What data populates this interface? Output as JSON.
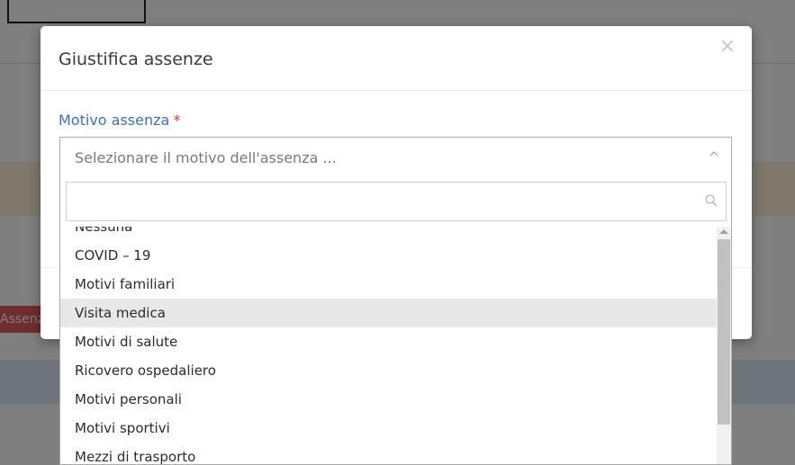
{
  "background": {
    "badge_text": "Assenza",
    "colors": {
      "backdrop": "#808080",
      "badge": "#e05a5a"
    }
  },
  "modal": {
    "title": "Giustifica assenze",
    "close_label": "×",
    "field": {
      "label": "Motivo assenza",
      "required_mark": "*"
    },
    "select": {
      "placeholder": "Selezionare il motivo dell'assenza ...",
      "arrow_icon": "chevron-up-icon",
      "search": {
        "value": "",
        "placeholder": "",
        "icon": "search-icon"
      },
      "options": [
        "Nessuna",
        "COVID – 19",
        "Motivi familiari",
        "Visita medica",
        "Motivi di salute",
        "Ricovero ospedaliero",
        "Motivi personali",
        "Motivi sportivi",
        "Mezzi di trasporto"
      ],
      "highlighted_option": "Visita medica"
    },
    "colors": {
      "label": "#3d70b2",
      "required": "#e03a3a",
      "highlight": "#e8e8e8"
    }
  }
}
